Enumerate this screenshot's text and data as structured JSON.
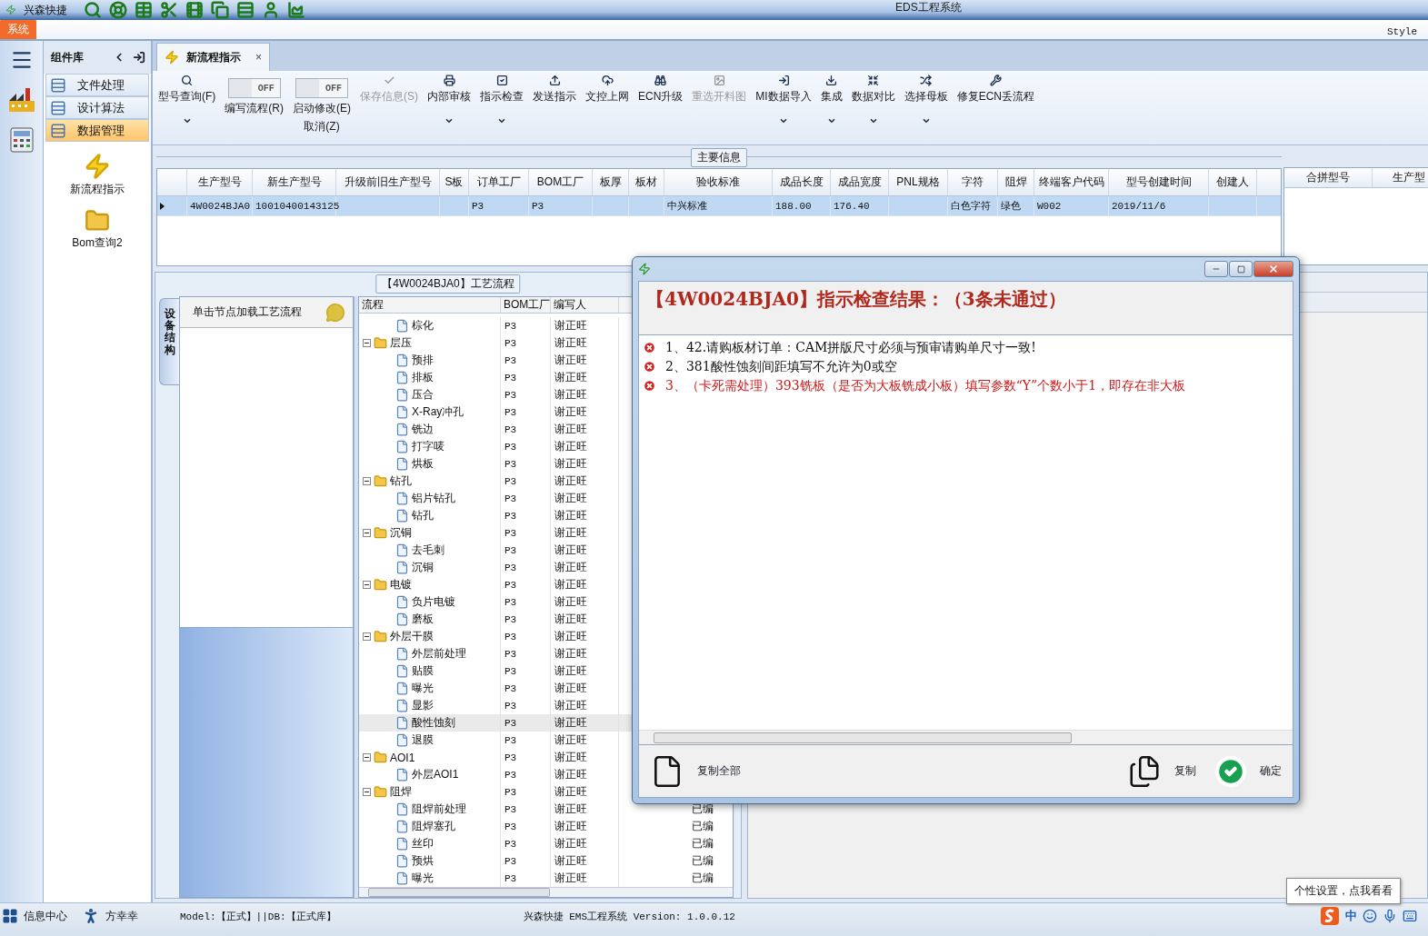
{
  "title_bar": {
    "app_name": "兴森快捷",
    "title": "EDS工程系统"
  },
  "ribbon": {
    "tab": "系统",
    "style_label": "Style"
  },
  "component_panel": {
    "title": "组件库",
    "items": [
      {
        "label": "文件处理",
        "selected": false
      },
      {
        "label": "设计算法",
        "selected": false
      },
      {
        "label": "数据管理",
        "selected": true
      }
    ],
    "shortcuts": [
      {
        "label": "新流程指示",
        "kind": "lightning"
      },
      {
        "label": "Bom查询2",
        "kind": "folder"
      }
    ]
  },
  "document_tab": {
    "label": "新流程指示",
    "close": "×"
  },
  "toolbar": [
    {
      "kind": "button",
      "label": "型号查询(F)",
      "dropdown": true,
      "disabled": false
    },
    {
      "kind": "toggle",
      "label": "编写流程(R)",
      "state_text": "OFF",
      "on": false
    },
    {
      "kind": "toggle",
      "label": "启动修改(E)",
      "sublabel": "取消(Z)",
      "state_text": "OFF",
      "on": false
    },
    {
      "kind": "button",
      "label": "保存信息(S)",
      "dropdown": false,
      "disabled": true
    },
    {
      "kind": "button",
      "label": "内部审核",
      "dropdown": true,
      "disabled": false
    },
    {
      "kind": "button",
      "label": "指示检查",
      "dropdown": true,
      "disabled": false
    },
    {
      "kind": "button",
      "label": "发送指示",
      "dropdown": false,
      "disabled": false
    },
    {
      "kind": "button",
      "label": "文控上网",
      "dropdown": false,
      "disabled": false
    },
    {
      "kind": "button",
      "label": "ECN升级",
      "dropdown": false,
      "disabled": false
    },
    {
      "kind": "button",
      "label": "重选开料图",
      "dropdown": false,
      "disabled": true
    },
    {
      "kind": "button",
      "label": "MI数据导入",
      "dropdown": true,
      "disabled": false
    },
    {
      "kind": "button",
      "label": "集成",
      "dropdown": true,
      "disabled": false
    },
    {
      "kind": "button",
      "label": "数据对比",
      "dropdown": true,
      "disabled": false
    },
    {
      "kind": "button",
      "label": "选择母板",
      "dropdown": true,
      "disabled": false
    },
    {
      "kind": "button",
      "label": "修复ECN丢流程",
      "dropdown": false,
      "disabled": false
    }
  ],
  "main_info": {
    "title": "主要信息",
    "columns": [
      "生产型号",
      "新生产型号",
      "升级前旧生产型号",
      "S板",
      "订单工厂",
      "BOM工厂",
      "板厚",
      "板材",
      "验收标准",
      "成品长度",
      "成品宽度",
      "PNL规格",
      "字符",
      "阻焊",
      "终端客户代码",
      "型号创建时间",
      "创建人"
    ],
    "rows": [
      {
        "selected": true,
        "cells": [
          "4W0024BJA0",
          "10010400143125",
          "",
          "",
          "P3",
          "P3",
          "",
          "",
          "中兴标准",
          "188.00",
          "176.40",
          "",
          "白色字符",
          "绿色",
          "W002",
          "2019/11/6",
          ""
        ]
      }
    ],
    "side_columns": [
      "合拼型号",
      "生产型"
    ]
  },
  "process": {
    "title": "【4W0024BJA0】工艺流程",
    "side_tab": "设备结构",
    "hint": "单击节点加载工艺流程",
    "columns": [
      "流程",
      "BOM工厂",
      "编写人"
    ],
    "tree": [
      {
        "children": [
          {
            "label": "棕化",
            "bom_factory": "P3",
            "writer": "谢正旺",
            "selected": false
          }
        ]
      },
      {
        "label": "层压",
        "bom_factory": "P3",
        "writer": "谢正旺",
        "selected": false,
        "expanded": true,
        "children": [
          {
            "label": "预排",
            "bom_factory": "P3",
            "writer": "谢正旺",
            "selected": false
          },
          {
            "label": "排板",
            "bom_factory": "P3",
            "writer": "谢正旺",
            "selected": false
          },
          {
            "label": "压合",
            "bom_factory": "P3",
            "writer": "谢正旺",
            "selected": false
          },
          {
            "label": "X-Ray冲孔",
            "bom_factory": "P3",
            "writer": "谢正旺",
            "selected": false
          },
          {
            "label": "铣边",
            "bom_factory": "P3",
            "writer": "谢正旺",
            "selected": false
          },
          {
            "label": "打字唛",
            "bom_factory": "P3",
            "writer": "谢正旺",
            "selected": false
          },
          {
            "label": "烘板",
            "bom_factory": "P3",
            "writer": "谢正旺",
            "selected": false
          }
        ]
      },
      {
        "label": "钻孔",
        "bom_factory": "P3",
        "writer": "谢正旺",
        "selected": false,
        "expanded": true,
        "children": [
          {
            "label": "铝片钻孔",
            "bom_factory": "P3",
            "writer": "谢正旺",
            "selected": false
          },
          {
            "label": "钻孔",
            "bom_factory": "P3",
            "writer": "谢正旺",
            "selected": false
          }
        ]
      },
      {
        "label": "沉铜",
        "bom_factory": "P3",
        "writer": "谢正旺",
        "selected": false,
        "expanded": true,
        "children": [
          {
            "label": "去毛刺",
            "bom_factory": "P3",
            "writer": "谢正旺",
            "selected": false
          },
          {
            "label": "沉铜",
            "bom_factory": "P3",
            "writer": "谢正旺",
            "selected": false
          }
        ]
      },
      {
        "label": "电镀",
        "bom_factory": "P3",
        "writer": "谢正旺",
        "selected": false,
        "expanded": true,
        "children": [
          {
            "label": "负片电镀",
            "bom_factory": "P3",
            "writer": "谢正旺",
            "selected": false
          },
          {
            "label": "磨板",
            "bom_factory": "P3",
            "writer": "谢正旺",
            "selected": false
          }
        ]
      },
      {
        "label": "外层干膜",
        "bom_factory": "P3",
        "writer": "谢正旺",
        "selected": false,
        "expanded": true,
        "children": [
          {
            "label": "外层前处理",
            "bom_factory": "P3",
            "writer": "谢正旺",
            "selected": false
          },
          {
            "label": "贴膜",
            "bom_factory": "P3",
            "writer": "谢正旺",
            "selected": false
          },
          {
            "label": "曝光",
            "bom_factory": "P3",
            "writer": "谢正旺",
            "selected": false
          },
          {
            "label": "显影",
            "bom_factory": "P3",
            "writer": "谢正旺",
            "selected": false
          },
          {
            "label": "酸性蚀刻",
            "bom_factory": "P3",
            "writer": "谢正旺",
            "selected": true
          },
          {
            "label": "退膜",
            "bom_factory": "P3",
            "writer": "谢正旺",
            "selected": false
          }
        ]
      },
      {
        "label": "AOI1",
        "bom_factory": "P3",
        "writer": "谢正旺",
        "selected": false,
        "expanded": true,
        "children": [
          {
            "label": "外层AOI1",
            "bom_factory": "P3",
            "writer": "谢正旺",
            "selected": false
          }
        ]
      },
      {
        "label": "阻焊",
        "bom_factory": "P3",
        "writer": "谢正旺",
        "selected": false,
        "expanded": true,
        "children": [
          {
            "label": "阻焊前处理",
            "bom_factory": "P3",
            "writer": "谢正旺",
            "selected": false,
            "status": "已编"
          },
          {
            "label": "阻焊塞孔",
            "bom_factory": "P3",
            "writer": "谢正旺",
            "selected": false,
            "status": "已编"
          },
          {
            "label": "丝印",
            "bom_factory": "P3",
            "writer": "谢正旺",
            "selected": false,
            "status": "已编"
          },
          {
            "label": "预烘",
            "bom_factory": "P3",
            "writer": "谢正旺",
            "selected": false,
            "status": "已编"
          },
          {
            "label": "曝光",
            "bom_factory": "P3",
            "writer": "谢正旺",
            "selected": false,
            "status": "已编"
          }
        ]
      }
    ]
  },
  "dialog": {
    "heading": "【4W0024BJA0】指示检查结果：（3条未通过）",
    "messages": [
      {
        "text": "1、42.请购板材订单：CAM拼版尺寸必须与预审请购单尺寸一致!",
        "color": "#111111"
      },
      {
        "text": "2、381酸性蚀刻间距填写不允许为0或空",
        "color": "#111111"
      },
      {
        "text": "3、（卡死需处理）393铣板（是否为大板铣成小板）填写参数“Y”个数小于1，即存在非大板",
        "color": "#cc1a1a"
      }
    ],
    "actions": [
      {
        "label": "复制全部",
        "kind": "document"
      },
      {
        "label": "复制",
        "kind": "copy"
      },
      {
        "label": "确定",
        "kind": "confirm"
      }
    ]
  },
  "status_bar": {
    "items": [
      {
        "label": "信息中心",
        "kind": "grid"
      },
      {
        "label": "方幸幸",
        "kind": "person"
      }
    ],
    "model": "Model:【正式】||DB:【正式库】",
    "version": "兴森快捷 EMS工程系统 Version: 1.0.0.12",
    "ime": "中"
  },
  "tooltip": "个性设置，点我看看"
}
